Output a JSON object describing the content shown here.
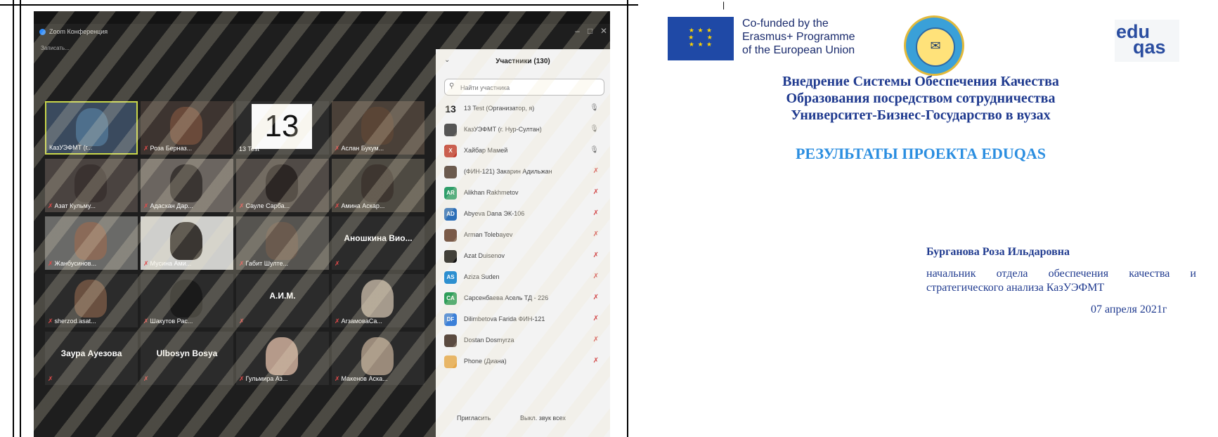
{
  "colors": {
    "eu_blue": "#1f49a6",
    "title_blue": "#1f3a8f",
    "result_blue": "#2b8ee0",
    "zoom_dark": "#1e1e1e"
  },
  "zoom": {
    "window_title": "Zoom Конференция",
    "subbar": "Записать...",
    "tiles": [
      {
        "label": "КазУЭФМТ (г..."
      },
      {
        "label": "Роза Берназ..."
      },
      {
        "label": "13 Test",
        "number": "13"
      },
      {
        "label": "Аслан Букум..."
      },
      {
        "label": "Азат Кульму..."
      },
      {
        "label": "Адасхан Дар..."
      },
      {
        "label": "Сауле Сарба..."
      },
      {
        "label": "Амина Аскар..."
      },
      {
        "label": "Жанбусинов..."
      },
      {
        "label": "Мусина Ами..."
      },
      {
        "label": "Габит Шулте..."
      },
      {
        "big": "Аношкина Вио..."
      },
      {
        "label": "sherzod.asat..."
      },
      {
        "label": "Шакутов Рас..."
      },
      {
        "big": "А.И.М."
      },
      {
        "label": "АгзамоваСа..."
      },
      {
        "big": "Заура Ауезова"
      },
      {
        "big": "Ulbosyn Bosya"
      },
      {
        "label": "Гульмира Аз..."
      },
      {
        "label": "Макенов Аска..."
      }
    ],
    "panel": {
      "title": "Участники (130)",
      "search_placeholder": "Найти участника",
      "participants": [
        {
          "avatar": "13",
          "name": "13 Test (Организатор, я)"
        },
        {
          "avatar": "",
          "name": "КазУЭФМТ (г. Нур-Султан)"
        },
        {
          "avatar": "Х",
          "name": "Хайбар Мамей"
        },
        {
          "avatar": "",
          "name": "(ФИН-121) Закарин Адильжан"
        },
        {
          "avatar": "AR",
          "name": "Alikhan Rakhmetov"
        },
        {
          "avatar": "AD",
          "name": "Abyeva Dana ЭК-106"
        },
        {
          "avatar": "",
          "name": "Arman Tolebayev"
        },
        {
          "avatar": "",
          "name": "Azat Duisenov"
        },
        {
          "avatar": "AS",
          "name": "Aziza Suden"
        },
        {
          "avatar": "CA",
          "name": "Сарсенбаева Асель ТД - 226"
        },
        {
          "avatar": "DF",
          "name": "Dilimbetova Farida ФИН-121"
        },
        {
          "avatar": "",
          "name": "Dostan Dosmyrza"
        },
        {
          "avatar": "",
          "name": "Phone (Диана)"
        }
      ],
      "invite_label": "Пригласить",
      "mute_all_label": "Выкл. звук всех"
    }
  },
  "slide": {
    "eu_text": [
      "Co-funded by the",
      "Erasmus+ Programme",
      "of the European Union"
    ],
    "eduqas_top": "edu",
    "eduqas_bottom": "qas",
    "title_lines": [
      "Внедрение Системы Обеспечения Качества",
      "Образования посредством сотрудничества",
      "Университет-Бизнес-Государство в вузах"
    ],
    "results": "РЕЗУЛЬТАТЫ ПРОЕКТА EDUQAS",
    "author": "Бурганова Роза Ильдаровна",
    "position": "начальник отдела обеспечения качества и стратегического анализа КазУЭФМТ",
    "date": "07 апреля 2021г"
  }
}
